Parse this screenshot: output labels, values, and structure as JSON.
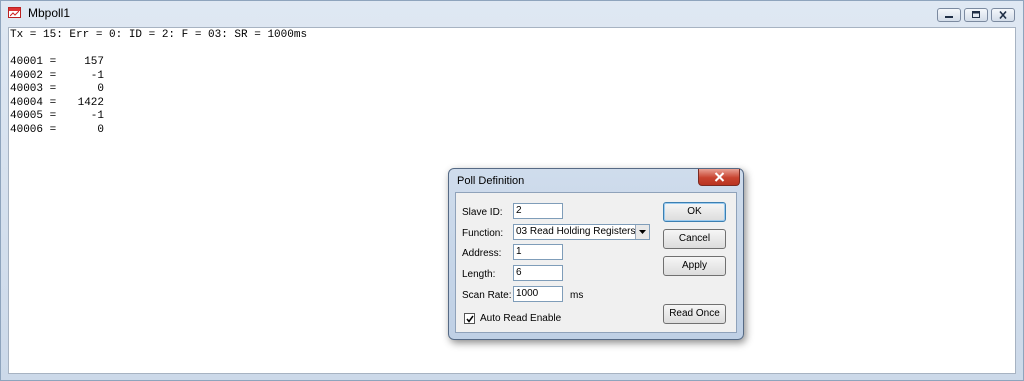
{
  "window": {
    "title": "Mbpoll1"
  },
  "status_line": "Tx = 15: Err = 0: ID = 2: F = 03: SR = 1000ms",
  "registers": [
    {
      "address": "40001 =",
      "value": "157"
    },
    {
      "address": "40002 =",
      "value": "-1"
    },
    {
      "address": "40003 =",
      "value": "0"
    },
    {
      "address": "40004 =",
      "value": "1422"
    },
    {
      "address": "40005 =",
      "value": "-1"
    },
    {
      "address": "40006 =",
      "value": "0"
    }
  ],
  "dialog": {
    "title": "Poll Definition",
    "slave_id_label": "Slave ID:",
    "slave_id_value": "2",
    "function_label": "Function:",
    "function_value": "03 Read Holding Registers",
    "address_label": "Address:",
    "address_value": "1",
    "length_label": "Length:",
    "length_value": "6",
    "scan_rate_label": "Scan Rate:",
    "scan_rate_value": "1000",
    "scan_rate_unit": "ms",
    "auto_read_label": "Auto Read Enable",
    "auto_read_checked": true,
    "ok_label": "OK",
    "cancel_label": "Cancel",
    "apply_label": "Apply",
    "read_once_label": "Read Once"
  },
  "icons": {
    "app": "mbpoll-app-icon",
    "minimize": "minimize-icon",
    "maximize": "maximize-icon",
    "close": "close-icon",
    "dropdown": "chevron-down-icon",
    "check": "check-icon"
  },
  "colors": {
    "dialog_close": "#c8432f",
    "frame": "#ccd9e9"
  }
}
